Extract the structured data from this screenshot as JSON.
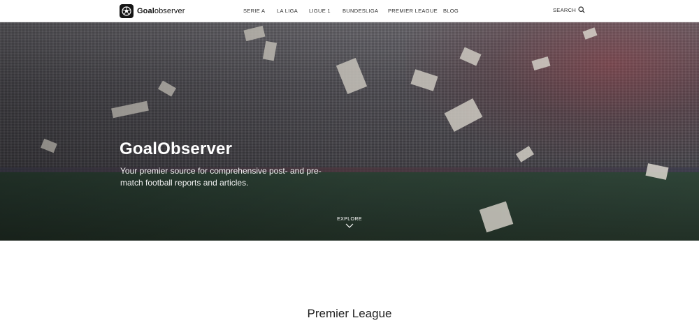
{
  "header": {
    "brand_bold": "Goal",
    "brand_regular": "observer",
    "nav": [
      {
        "label": "SERIE A"
      },
      {
        "label": "LA LIGA"
      },
      {
        "label": "LIGUE 1"
      },
      {
        "label": "BUNDESLIGA"
      },
      {
        "label": "PREMIER LEAGUE"
      },
      {
        "label": "BLOG"
      }
    ],
    "search_label": "SEARCH"
  },
  "hero": {
    "title": "GoalObserver",
    "subtitle": "Your premier source for comprehensive post- and pre-match football reports and articles.",
    "explore_label": "EXPLORE"
  },
  "section": {
    "title": "Premier League"
  },
  "icons": {
    "brand": "soccer-ball-icon",
    "search": "magnifier-icon",
    "explore": "chevron-down-icon"
  },
  "colors": {
    "header_bg": "#ffffff",
    "brand_icon_bg": "#151515",
    "hero_text": "#ffffff"
  }
}
